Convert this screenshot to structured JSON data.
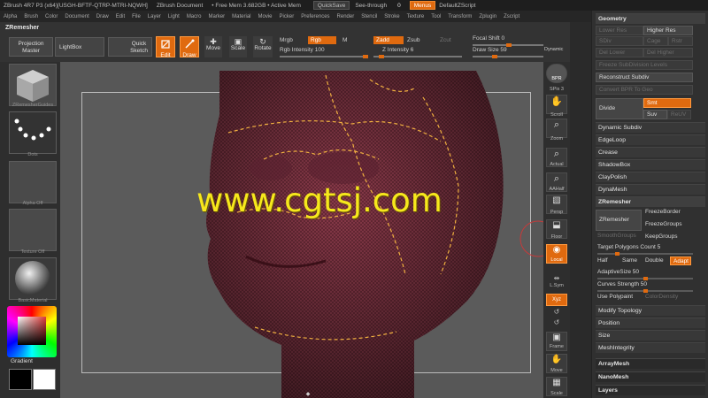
{
  "titlebar": {
    "app": "ZBrush 4R7 P3 (x64)[USGH-BFTF-QTRP-MTRI-NQWH]",
    "doc": "ZBrush Document",
    "mem": "• Free Mem 3.682GB • Active Mem",
    "quicksave": "QuickSave",
    "seethrough_label": "See-through",
    "seethrough_value": "0",
    "menus": "Menus",
    "script": "DefaultZScript"
  },
  "menubar": {
    "items": [
      "Alpha",
      "Brush",
      "Color",
      "Document",
      "Draw",
      "Edit",
      "File",
      "Layer",
      "Light",
      "Macro",
      "Marker",
      "Material",
      "Movie",
      "Picker",
      "Preferences",
      "Render",
      "Stencil",
      "Stroke",
      "Texture",
      "Tool",
      "Transform",
      "Zplugin",
      "Zscript"
    ]
  },
  "toolbar": {
    "panel_title": "ZRemesher",
    "projection_master": "Projection Master",
    "lightbox": "LightBox",
    "quick_sketch": "Quick Sketch",
    "edit": "Edit",
    "draw": "Draw",
    "move": "Move",
    "scale": "Scale",
    "rotate": "Rotate",
    "mrgb": "Mrgb",
    "rgb": "Rgb",
    "m": "M",
    "zadd": "Zadd",
    "zsub": "Zsub",
    "zcut": "Zcut",
    "rgb_intensity": "Rgb Intensity 100",
    "z_intensity": "Z Intensity 6",
    "focal_shift": "Focal Shift 0",
    "draw_size": "Draw Size 59",
    "dynamic": "Dynamic"
  },
  "leftshelf": {
    "brush_label": "ZRemesherGuides",
    "stroke_label": "Dots",
    "alpha_label": "Alpha Off",
    "texture_label": "Texture Off",
    "material_label": "BasicMaterial",
    "gradient_label": "Gradient"
  },
  "rightshelf": {
    "bpr": "BPR",
    "spix": "SPix 3",
    "scroll": "Scroll",
    "zoom": "Zoom",
    "actual": "Actual",
    "aahalf": "AAHalf",
    "persp": "Persp",
    "floor": "Floor",
    "local": "Local",
    "lsym": "L.Sym",
    "xyz": "Xyz",
    "frame": "Frame",
    "move": "Move",
    "scale": "Scale"
  },
  "tray": {
    "geometry": "Geometry",
    "lower_res": "Lower Res",
    "higher_res": "Higher Res",
    "sdiv": "SDiv",
    "cage": "Cage",
    "rstr": "Rstr",
    "del_lower": "Del Lower",
    "del_higher": "Del Higher",
    "freeze_subdiv": "Freeze SubDivision Levels",
    "reconstruct_subdiv": "Reconstruct Subdiv",
    "convert_bpr": "Convert BPR To Geo",
    "divide": "Divide",
    "smt": "Smt",
    "suv": "Suv",
    "reuv": "ReUV",
    "dynamic_subdiv": "Dynamic Subdiv",
    "edgeloop": "EdgeLoop",
    "crease": "Crease",
    "shadowbox": "ShadowBox",
    "claypolish": "ClayPolish",
    "dynamesh": "DynaMesh",
    "zremesher": "ZRemesher",
    "zremesher_btn": "ZRemesher",
    "freeze_border": "FreezeBorder",
    "freeze_groups": "FreezeGroups",
    "smooth_groups": "SmoothGroups",
    "keep_groups": "KeepGroups",
    "target_polygons": "Target Polygons Count 5",
    "half": "Half",
    "same": "Same",
    "double": "Double",
    "adapt": "Adapt",
    "adaptive_size": "AdaptiveSize 50",
    "curves_strength": "Curves Strength 50",
    "use_polypaint": "Use Polypaint",
    "color_density": "ColorDensity",
    "modify_topology": "Modify Topology",
    "position": "Position",
    "size": "Size",
    "meshintegrity": "MeshIntegrity",
    "arraymesh": "ArrayMesh",
    "nanomesh": "NanoMesh",
    "layers": "Layers"
  },
  "watermark": "www.cgtsj.com",
  "colors": {
    "accent": "#e06a0f",
    "panel": "#303030",
    "canvas": "#575757",
    "mesh": "#8a3a4a"
  }
}
